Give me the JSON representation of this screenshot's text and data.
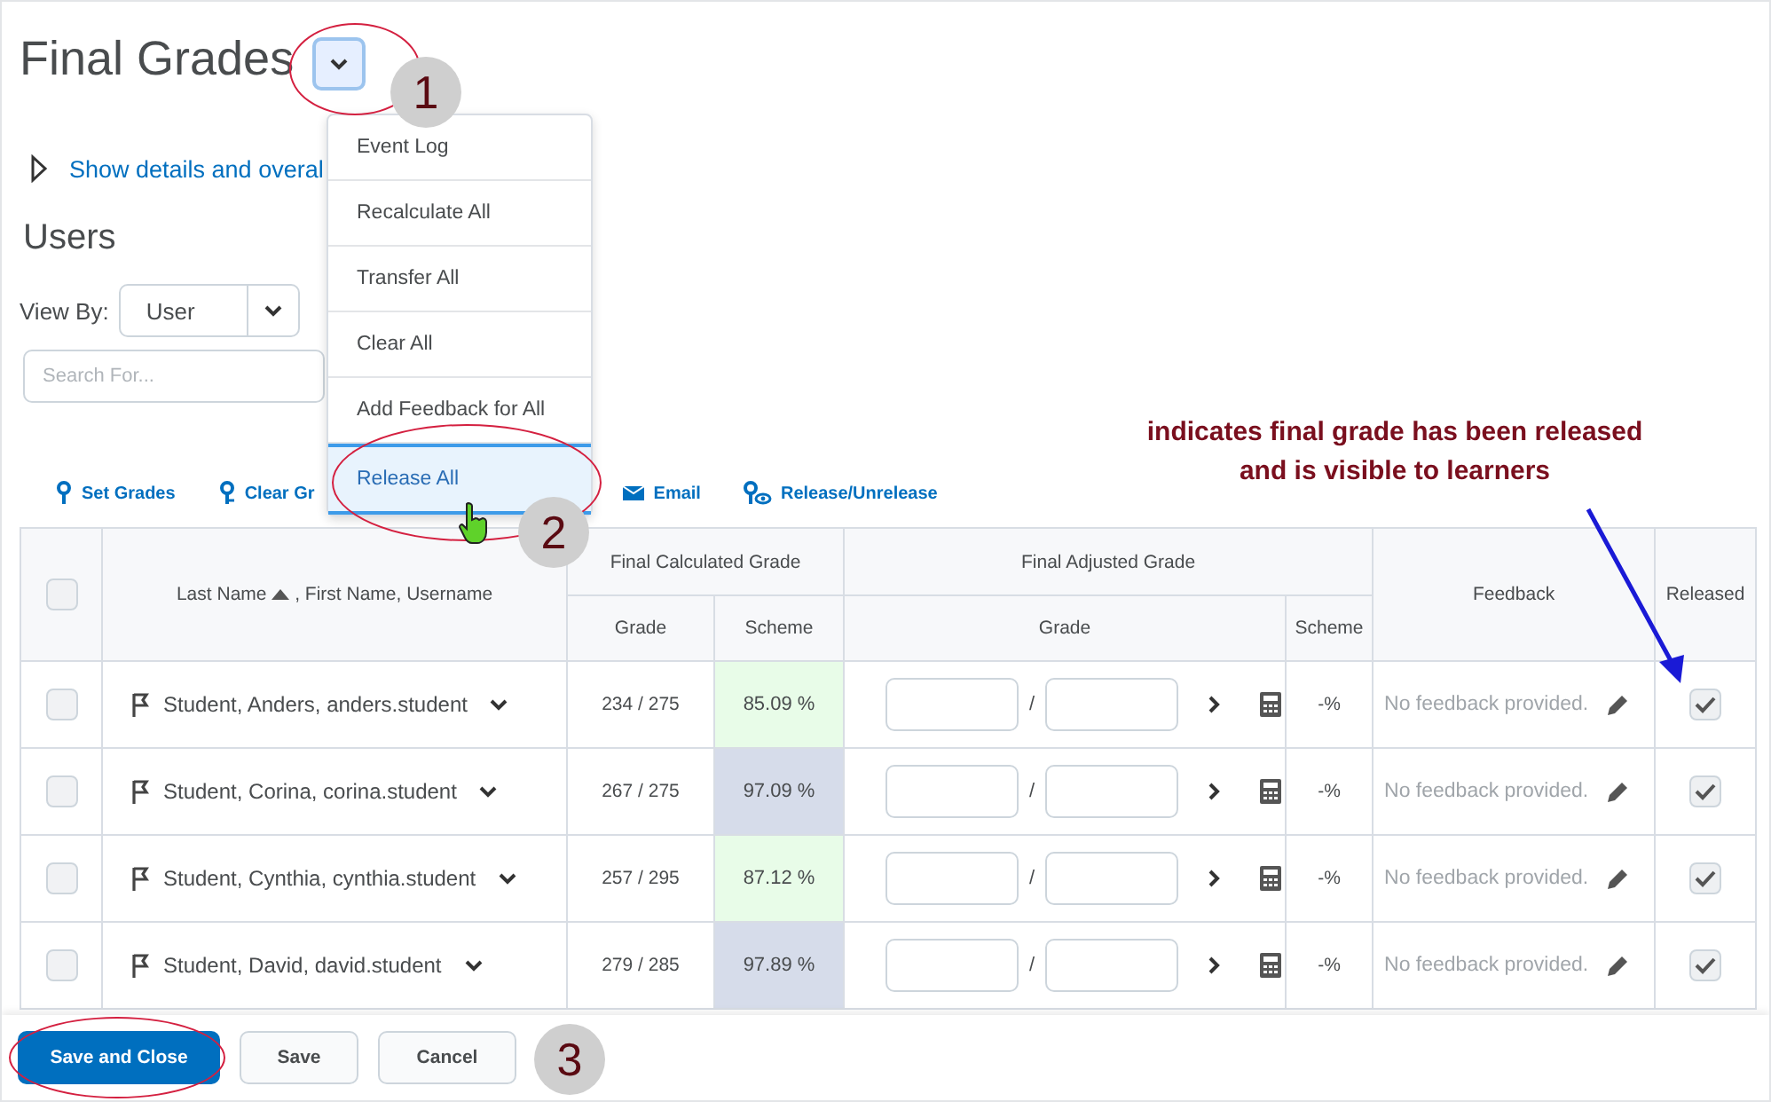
{
  "title": "Final Grades",
  "details_link": "Show details and overal",
  "users_heading": "Users",
  "view_by": {
    "label": "View By:",
    "value": "User"
  },
  "search": {
    "placeholder": "Search For..."
  },
  "menu": [
    {
      "label": "Event Log",
      "selected": false
    },
    {
      "label": "Recalculate All",
      "selected": false
    },
    {
      "label": "Transfer All",
      "selected": false
    },
    {
      "label": "Clear All",
      "selected": false
    },
    {
      "label": "Add Feedback for All",
      "selected": false
    },
    {
      "label": "Release All",
      "selected": true
    }
  ],
  "toolbar": [
    {
      "kind": "set",
      "label": "Set Grades"
    },
    {
      "kind": "clear",
      "label": "Clear Gr"
    },
    {
      "kind": "email",
      "label": "Email"
    },
    {
      "kind": "release",
      "label": "Release/Unrelease"
    }
  ],
  "annotation": "indicates final grade has been released and is visible to learners",
  "callouts": [
    "1",
    "2",
    "3"
  ],
  "table": {
    "select_all_checked": false,
    "name_header": "Last Name",
    "name_header_rest": ", First Name, Username",
    "calc_header": "Final Calculated Grade",
    "adj_header": "Final Adjusted Grade",
    "grade_header": "Grade",
    "scheme_header": "Scheme",
    "adj_grade_header": "Grade",
    "adj_scheme_header": "Scheme",
    "feedback_header": "Feedback",
    "released_header": "Released",
    "rows": [
      {
        "selected": false,
        "name": "Student, Anders, anders.student",
        "grade": "234 / 275",
        "scheme": "85.09 %",
        "color": "#e8fce8",
        "separator": "/",
        "adj_scheme": "-%",
        "feedback": "No feedback provided.",
        "released": true
      },
      {
        "selected": false,
        "name": "Student, Corina, corina.student",
        "grade": "267 / 275",
        "scheme": "97.09 %",
        "color": "#d6dcea",
        "separator": "/",
        "adj_scheme": "-%",
        "feedback": "No feedback provided.",
        "released": true
      },
      {
        "selected": false,
        "name": "Student, Cynthia, cynthia.student",
        "grade": "257 / 295",
        "scheme": "87.12 %",
        "color": "#e8fce8",
        "separator": "/",
        "adj_scheme": "-%",
        "feedback": "No feedback provided.",
        "released": true
      },
      {
        "selected": false,
        "name": "Student, David, david.student",
        "grade": "279 / 285",
        "scheme": "97.89 %",
        "color": "#d6dcea",
        "separator": "/",
        "adj_scheme": "-%",
        "feedback": "No feedback provided.",
        "released": true
      }
    ]
  },
  "footer": [
    {
      "kind": "primary",
      "label": "Save and Close"
    },
    {
      "kind": "secondary",
      "label": "Save"
    },
    {
      "kind": "secondary",
      "label": "Cancel"
    }
  ]
}
